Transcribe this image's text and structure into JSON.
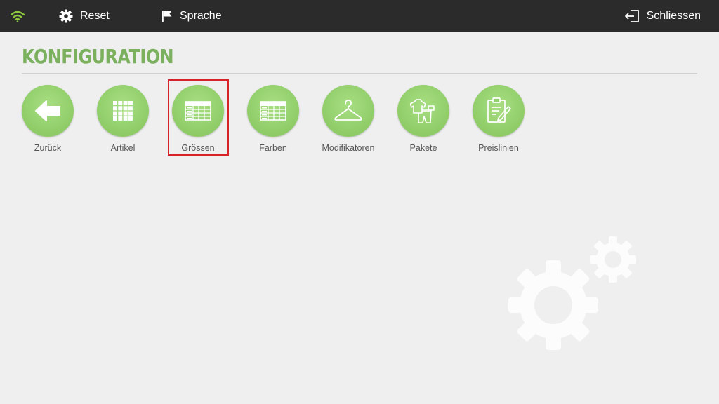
{
  "topbar": {
    "wifi_icon": "wifi-icon",
    "reset_label": "Reset",
    "sprache_label": "Sprache",
    "close_label": "Schliessen"
  },
  "page": {
    "title": "KONFIGURATION"
  },
  "tiles": [
    {
      "label": "Zurück",
      "icon": "arrow-left-icon"
    },
    {
      "label": "Artikel",
      "icon": "grid-icon"
    },
    {
      "label": "Grössen",
      "icon": "table-icon",
      "selected": true
    },
    {
      "label": "Farben",
      "icon": "table-icon"
    },
    {
      "label": "Modifikatoren",
      "icon": "hanger-icon"
    },
    {
      "label": "Pakete",
      "icon": "outfit-icon"
    },
    {
      "label": "Preislinien",
      "icon": "clipboard-edit-icon"
    }
  ],
  "colors": {
    "topbar_bg": "#2b2b2b",
    "accent_green": "#7bb15e",
    "tile_green": "#92cf6b",
    "wifi_green": "#8cc63f",
    "highlight_red": "#d6232a"
  }
}
